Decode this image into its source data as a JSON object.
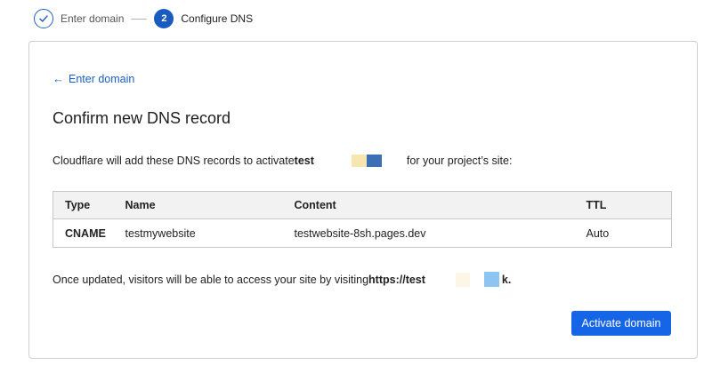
{
  "stepper": {
    "steps": [
      {
        "label": "Enter domain",
        "state": "done",
        "icon": "check-icon"
      },
      {
        "label": "Configure DNS",
        "state": "active",
        "number": "2"
      }
    ]
  },
  "card": {
    "back_link": "Enter domain",
    "title": "Confirm new DNS record",
    "intro": {
      "before": "Cloudflare will add these DNS records to activate ",
      "domain_visible": "test",
      "after": "for your project’s site:"
    },
    "table": {
      "headers": [
        "Type",
        "Name",
        "Content",
        "TTL"
      ],
      "rows": [
        {
          "type": "CNAME",
          "name": "testmywebsite",
          "content": "testwebsite-8sh.pages.dev",
          "ttl": "Auto"
        }
      ]
    },
    "outro": {
      "before": "Once updated, visitors will be able to access your site by visiting ",
      "url_visible": "https://test",
      "url_end": "k."
    },
    "activate_button": "Activate domain"
  },
  "colors": {
    "accent": "#1a5bbf",
    "button": "#1565e6",
    "link": "#1a5fc4"
  }
}
